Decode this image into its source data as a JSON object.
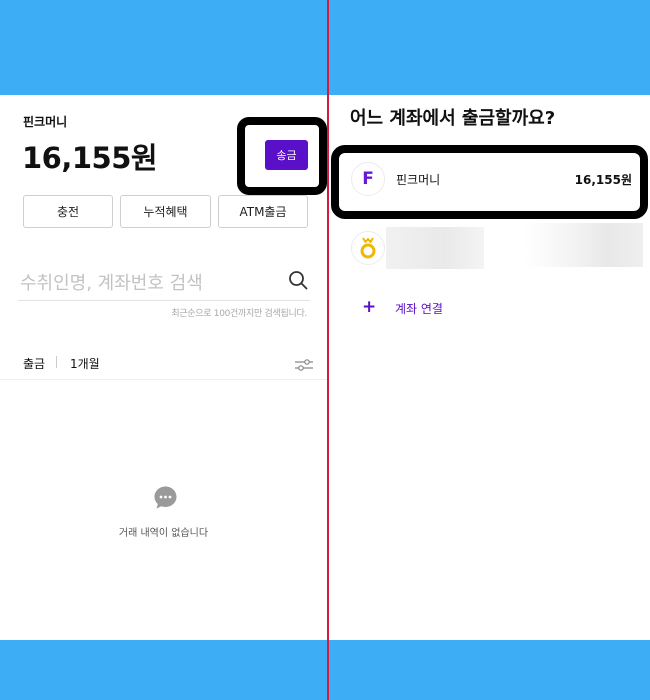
{
  "left": {
    "wallet_name": "핀크머니",
    "balance": "16,155원",
    "send_label": "송금",
    "buttons": [
      "충전",
      "누적혜택",
      "ATM출금"
    ],
    "search_placeholder": "수취인명, 계좌번호 검색",
    "search_note": "최근순으로 100건까지만 검색됩니다.",
    "filter_type": "출금",
    "filter_period": "1개월",
    "empty_text": "거래 내역이 없습니다"
  },
  "right": {
    "question": "어느 계좌에서 출금할까요?",
    "account": {
      "icon_letter": "F",
      "name": "핀크머니",
      "amount": "16,155원"
    },
    "link_plus": "+",
    "link_label": "계좌 연결"
  },
  "colors": {
    "background": "#3daef5",
    "accent": "#5a0fc8",
    "divider": "#d7193f",
    "bank_icon": "#f2b705"
  },
  "icons": [
    "search-icon",
    "filter-icon",
    "chat-bubble-icon",
    "pinkmoney-logo-icon",
    "bank-logo-icon",
    "plus-icon"
  ]
}
